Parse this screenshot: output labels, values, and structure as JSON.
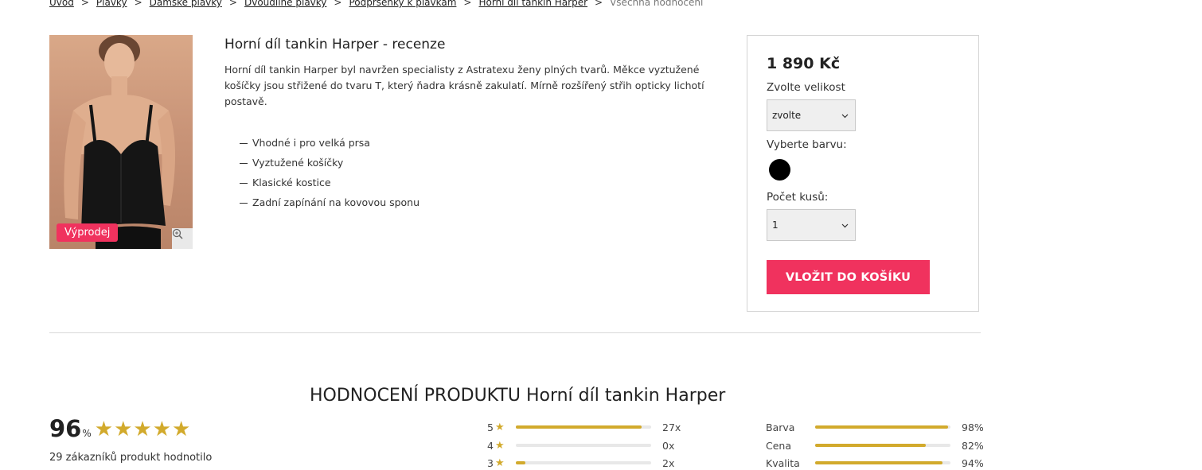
{
  "breadcrumb": {
    "items": [
      "Úvod",
      "Plavky",
      "Dámské plavky",
      "Dvoudílné plavky",
      "Podprsenky k plavkám",
      "Horní díl tankin Harper"
    ],
    "current": "Všechna hodnocení",
    "separator": ">"
  },
  "product": {
    "sale_badge": "Výprodej",
    "title": "Horní díl tankin Harper - recenze",
    "description": "Horní díl tankin Harper byl navržen specialisty z Astratexu ženy plných tvarů. Měkce vyztužené košíčky jsou střižené do tvaru T, který ňadra krásně zakulatí. Mírně rozšířený střih opticky lichotí postavě.",
    "features": [
      "Vhodné i pro velká prsa",
      "Vyztužené košíčky",
      "Klasické kostice",
      "Zadní zapínání na kovovou sponu"
    ]
  },
  "buy_box": {
    "price": "1 890 Kč",
    "size_label": "Zvolte velikost",
    "size_value": "zvolte",
    "color_label": "Vyberte barvu:",
    "color_value": "#000000",
    "qty_label": "Počet kusů:",
    "qty_value": "1",
    "add_to_cart": "VLOŽIT DO KOŠÍKU"
  },
  "rating": {
    "title": "HODNOCENÍ PRODUKTU Horní díl tankin Harper",
    "score": "96",
    "score_unit": "%",
    "stars": 5,
    "customers": "29 zákazníků produkt hodnotilo",
    "distribution": [
      {
        "stars": "5",
        "count": "27x",
        "fraction": 0.93
      },
      {
        "stars": "4",
        "count": "0x",
        "fraction": 0.0
      },
      {
        "stars": "3",
        "count": "2x",
        "fraction": 0.07
      }
    ],
    "criteria": [
      {
        "name": "Barva",
        "percent": "98%",
        "fraction": 0.98
      },
      {
        "name": "Cena",
        "percent": "82%",
        "fraction": 0.82
      },
      {
        "name": "Kvalita",
        "percent": "94%",
        "fraction": 0.94
      }
    ]
  },
  "colors": {
    "accent": "#f0325e",
    "star": "#d2aa2c"
  }
}
